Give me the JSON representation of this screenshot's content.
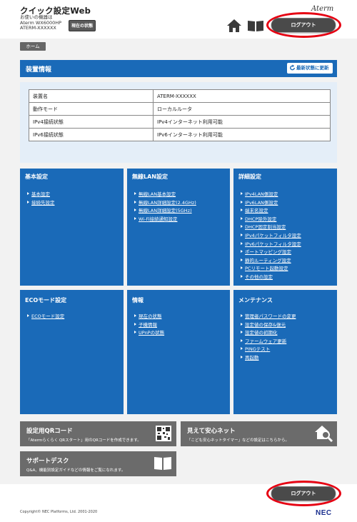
{
  "header": {
    "app_title": "クイック設定Web",
    "device_label": "お使いの機器は",
    "model": "Aterm WX6000HP",
    "device_name": "ATERM-XXXXXX",
    "status_button": "現在の状態",
    "logo": "Aterm",
    "logout": "ログアウト"
  },
  "breadcrumb": {
    "home": "ホーム"
  },
  "device_info": {
    "title": "装置情報",
    "refresh": "最新状態に更新",
    "rows": [
      {
        "key": "装置名",
        "value": "ATERM-XXXXXX"
      },
      {
        "key": "動作モード",
        "value": "ローカルルータ"
      },
      {
        "key": "IPv4接続状態",
        "value": "IPv4インターネット利用可能"
      },
      {
        "key": "IPv6接続状態",
        "value": "IPv6インターネット利用可能"
      }
    ]
  },
  "menus": {
    "basic": {
      "title": "基本設定",
      "items": [
        "基本設定",
        "接続先設定"
      ]
    },
    "wlan": {
      "title": "無線LAN設定",
      "items": [
        "無線LAN基本設定",
        "無線LAN詳細設定(2.4GHz)",
        "無線LAN詳細設定(5GHz)",
        "Wi-Fi接続通知設定"
      ]
    },
    "advanced": {
      "title": "詳細設定",
      "items": [
        "IPv4LAN側設定",
        "IPv6LAN側設定",
        "端末名設定",
        "DHCP除外設定",
        "DHCP固定割当設定",
        "IPv4パケットフィルタ設定",
        "IPv6パケットフィルタ設定",
        "ポートマッピング設定",
        "静的ルーティング設定",
        "PCリモート起動設定",
        "その他の設定"
      ]
    },
    "eco": {
      "title": "ECOモード設定",
      "items": [
        "ECOモード設定"
      ]
    },
    "info": {
      "title": "情報",
      "items": [
        "現在の状態",
        "子機情報",
        "UPnPの状態"
      ]
    },
    "maintenance": {
      "title": "メンテナンス",
      "items": [
        "管理者パスワードの変更",
        "設定値の保存&復元",
        "設定値の初期化",
        "ファームウェア更新",
        "PINGテスト",
        "再起動"
      ]
    }
  },
  "bottom_tiles": {
    "qr": {
      "title": "設定用QRコード",
      "desc": "「Atermらくらく QRスタート」用のQRコードを作成できます。"
    },
    "mieru": {
      "title": "見えて安心ネット",
      "desc": "「こども安心ネットタイマー」などの設定はこちらから。"
    },
    "support": {
      "title": "サポートデスク",
      "desc": "Q&A、機能別設定ガイドなどの情報をご覧になれます。"
    }
  },
  "footer": {
    "copyright": "Copyright© NEC Platforms, Ltd. 2001-2020",
    "brand": "NEC"
  },
  "colors": {
    "accent_blue": "#1a6ab8",
    "highlight_red": "#e60012",
    "tile_gray": "#6b6b6b"
  }
}
